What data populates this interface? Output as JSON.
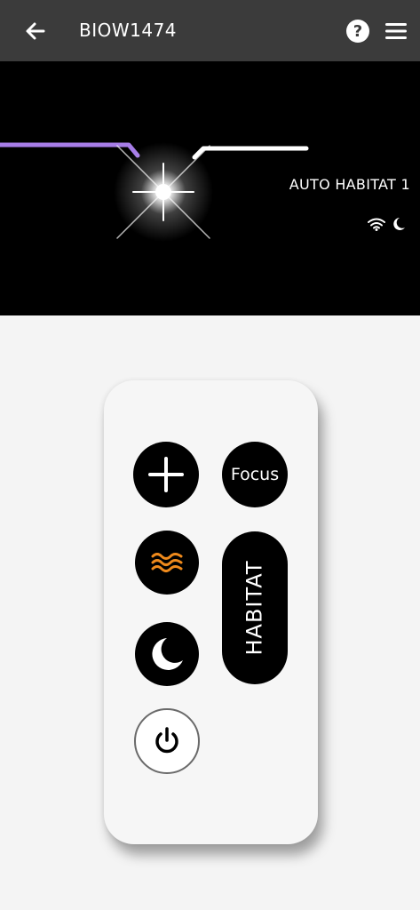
{
  "header": {
    "title": "BIOW1474",
    "back_icon": "arrow-left-icon",
    "help_label": "?",
    "menu_icon": "hamburger-menu-icon"
  },
  "hero": {
    "mode_label": "AUTO HABITAT 1",
    "status_icons": [
      "wifi-icon",
      "moon-icon"
    ],
    "accent_color": "#a77de8",
    "light_color": "#ffffff"
  },
  "remote": {
    "plus_icon": "plus-icon",
    "focus_label": "Focus",
    "wave_icon": "waves-icon",
    "wave_color": "#ef8a1c",
    "habitat_label": "HABITAT",
    "moon_icon": "moon-icon",
    "power_icon": "power-icon"
  }
}
